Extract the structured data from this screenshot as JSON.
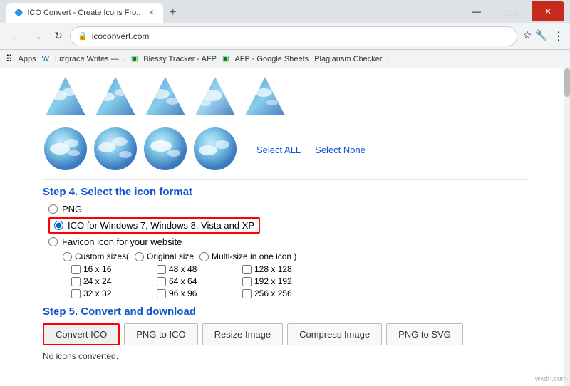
{
  "browser": {
    "title": "ICO Convert - Create Icons From ...",
    "tab_label": "ICO Convert - Create Icons Fro...",
    "tab_favicon": "🔷",
    "url": "icoconvert.com",
    "new_tab_symbol": "+",
    "back_symbol": "←",
    "forward_symbol": "→",
    "refresh_symbol": "↺",
    "home_symbol": "🏠",
    "lock_symbol": "🔒"
  },
  "bookmarks": [
    {
      "label": "Apps"
    },
    {
      "label": "Lizgrace Writes —..."
    },
    {
      "label": "Blessy Tracker - AFP"
    },
    {
      "label": "AFP - Google Sheets"
    },
    {
      "label": "Plagiarism Checker..."
    }
  ],
  "icons_row1": {
    "items": [
      "triangle1",
      "triangle2",
      "triangle3",
      "triangle4",
      "triangle5"
    ]
  },
  "icons_row2": {
    "items": [
      "circle1",
      "circle2",
      "circle3",
      "circle4"
    ]
  },
  "select_all_label": "Select ALL",
  "select_none_label": "Select None",
  "step4": {
    "title": "Step 4. Select the icon format",
    "options": [
      {
        "id": "opt-png",
        "label": "PNG"
      },
      {
        "id": "opt-ico",
        "label": "ICO for Windows 7, Windows 8, Vista and XP",
        "selected": true,
        "boxed": true
      },
      {
        "id": "opt-favicon",
        "label": "Favicon icon for your website"
      }
    ],
    "size_presets": [
      {
        "label": "Custom sizes(",
        "id": "custom"
      },
      {
        "label": "Original size",
        "id": "original"
      },
      {
        "label": "Multi-size in one icon )",
        "id": "multi"
      }
    ],
    "sizes": [
      "16 x 16",
      "48 x 48",
      "128 x 128",
      "24 x 24",
      "64 x 64",
      "192 x 192",
      "32 x 32",
      "96 x 96",
      "256 x 256"
    ]
  },
  "step5": {
    "title": "Step 5. Convert and download",
    "buttons": [
      {
        "label": "Convert ICO",
        "primary": true
      },
      {
        "label": "PNG to ICO"
      },
      {
        "label": "Resize Image"
      },
      {
        "label": "Compress Image"
      },
      {
        "label": "PNG to SVG"
      }
    ],
    "status": "No icons converted."
  },
  "watermark": "wxdn.com"
}
